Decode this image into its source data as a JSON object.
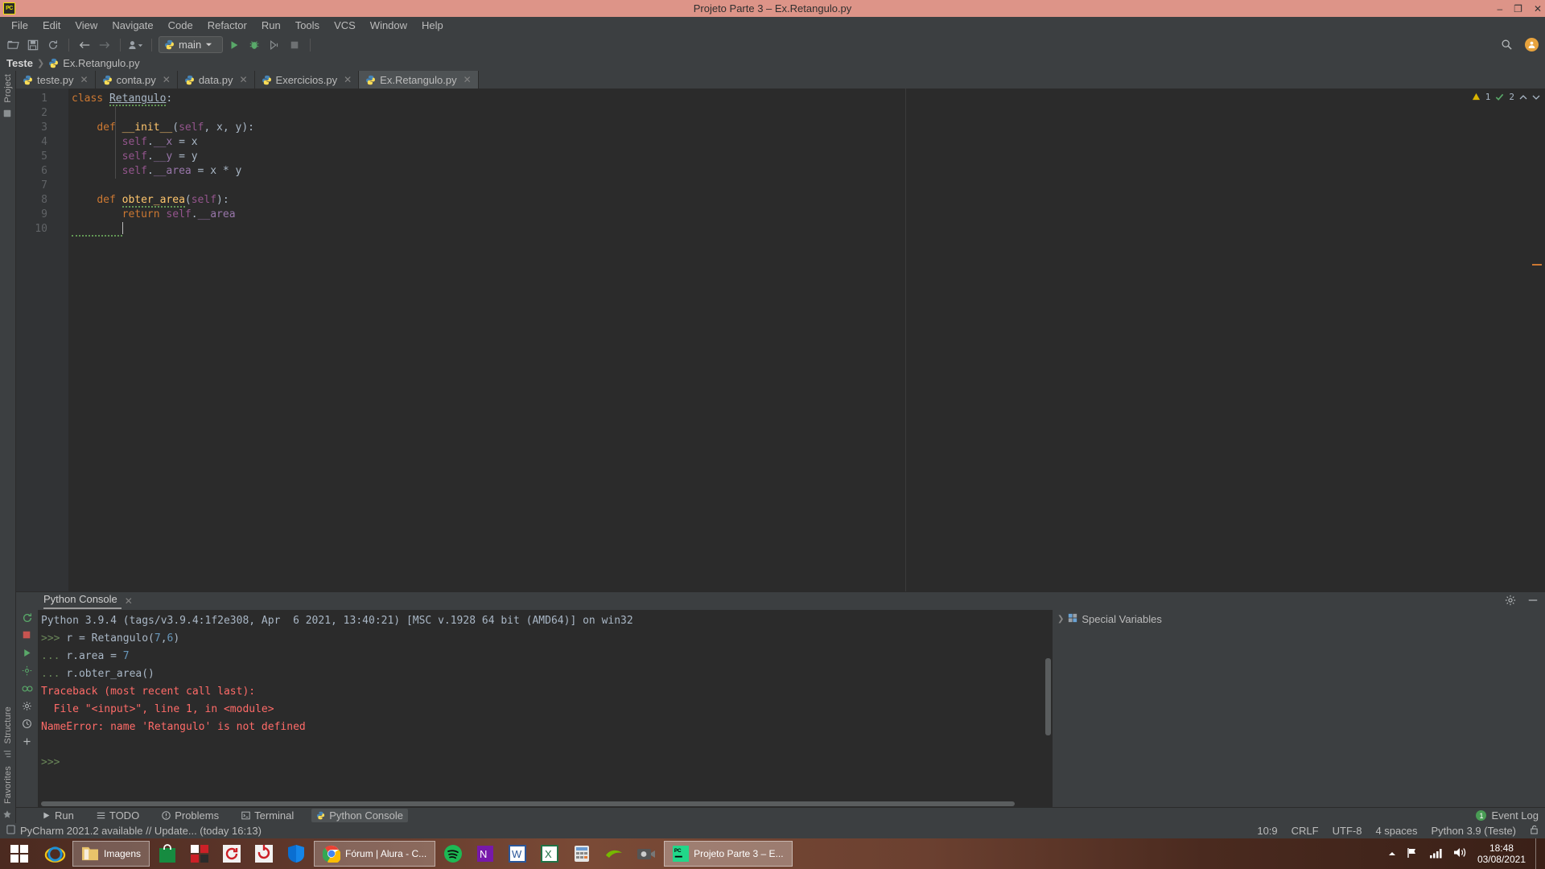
{
  "window": {
    "title": "Projeto Parte 3 – Ex.Retangulo.py",
    "logo_text": "PC",
    "minimize": "–",
    "maximize": "❐",
    "close": "✕"
  },
  "menubar": {
    "items": [
      {
        "label": "File"
      },
      {
        "label": "Edit"
      },
      {
        "label": "View"
      },
      {
        "label": "Navigate"
      },
      {
        "label": "Code"
      },
      {
        "label": "Refactor"
      },
      {
        "label": "Run"
      },
      {
        "label": "Tools"
      },
      {
        "label": "VCS"
      },
      {
        "label": "Window"
      },
      {
        "label": "Help"
      }
    ]
  },
  "toolbar": {
    "open_icon": "folder-open-icon",
    "save_icon": "save-icon",
    "sync_icon": "sync-icon",
    "back_icon": "back-arrow-icon",
    "forward_icon": "forward-arrow-icon",
    "profile_icon": "user-dropdown-icon",
    "run_config": "main",
    "run_icon": "run-icon",
    "debug_icon": "debug-icon",
    "coverage_icon": "run-coverage-icon",
    "stop_icon": "stop-icon",
    "search_icon": "search-icon",
    "account_icon": "account-avatar-icon"
  },
  "breadcrumb": {
    "project": "Teste",
    "separator": "❯",
    "file": "Ex.Retangulo.py"
  },
  "left_rail": {
    "project_label": "Project",
    "structure_label": "Structure",
    "favorites_label": "Favorites"
  },
  "tabs": [
    {
      "label": "teste.py",
      "active": false,
      "close": "✕"
    },
    {
      "label": "conta.py",
      "active": false,
      "close": "✕"
    },
    {
      "label": "data.py",
      "active": false,
      "close": "✕"
    },
    {
      "label": "Exercicios.py",
      "active": false,
      "close": "✕"
    },
    {
      "label": "Ex.Retangulo.py",
      "active": true,
      "close": "✕"
    }
  ],
  "editor": {
    "line_numbers": [
      "1",
      "2",
      "3",
      "4",
      "5",
      "6",
      "7",
      "8",
      "9",
      "10"
    ],
    "lines": [
      {
        "n": 1,
        "tokens": [
          {
            "t": "class ",
            "c": "kw"
          },
          {
            "t": "Retangulo",
            "c": "cls"
          },
          {
            "t": ":",
            "c": "pln"
          }
        ],
        "fold": "open"
      },
      {
        "n": 2,
        "tokens": []
      },
      {
        "n": 3,
        "tokens": [
          {
            "t": "    ",
            "c": "pln"
          },
          {
            "t": "def ",
            "c": "kw"
          },
          {
            "t": "__init__",
            "c": "fn"
          },
          {
            "t": "(",
            "c": "pln"
          },
          {
            "t": "self",
            "c": "slf"
          },
          {
            "t": ", x, y):",
            "c": "pln"
          }
        ],
        "fold": "open"
      },
      {
        "n": 4,
        "tokens": [
          {
            "t": "        ",
            "c": "pln"
          },
          {
            "t": "self",
            "c": "slf"
          },
          {
            "t": ".",
            "c": "pln"
          },
          {
            "t": "__x",
            "c": "pnk"
          },
          {
            "t": " = x",
            "c": "pln"
          }
        ]
      },
      {
        "n": 5,
        "tokens": [
          {
            "t": "        ",
            "c": "pln"
          },
          {
            "t": "self",
            "c": "slf"
          },
          {
            "t": ".",
            "c": "pln"
          },
          {
            "t": "__y",
            "c": "pnk"
          },
          {
            "t": " = y",
            "c": "pln"
          }
        ]
      },
      {
        "n": 6,
        "tokens": [
          {
            "t": "        ",
            "c": "pln"
          },
          {
            "t": "self",
            "c": "slf"
          },
          {
            "t": ".",
            "c": "pln"
          },
          {
            "t": "__area",
            "c": "pnk"
          },
          {
            "t": " = x * y",
            "c": "pln"
          }
        ],
        "fold": "close"
      },
      {
        "n": 7,
        "tokens": []
      },
      {
        "n": 8,
        "tokens": [
          {
            "t": "    ",
            "c": "pln"
          },
          {
            "t": "def ",
            "c": "kw"
          },
          {
            "t": "obter_area",
            "c": "fn"
          },
          {
            "t": "(",
            "c": "pln"
          },
          {
            "t": "self",
            "c": "slf"
          },
          {
            "t": "):",
            "c": "pln"
          }
        ],
        "fold": "open"
      },
      {
        "n": 9,
        "tokens": [
          {
            "t": "        ",
            "c": "pln"
          },
          {
            "t": "return ",
            "c": "kw"
          },
          {
            "t": "self",
            "c": "slf"
          },
          {
            "t": ".",
            "c": "pln"
          },
          {
            "t": "__area",
            "c": "pnk"
          }
        ],
        "fold": "close"
      },
      {
        "n": 10,
        "tokens": []
      }
    ],
    "inspection": {
      "warning_count": "1",
      "ok_count": "2",
      "warning_icon": "warning-triangle-icon",
      "ok_icon": "checkmark-icon",
      "up_icon": "chevron-up-icon",
      "down_icon": "chevron-down-icon"
    }
  },
  "console": {
    "tab_label": "Python Console",
    "tab_close": "✕",
    "settings_icon": "gear-icon",
    "hide_icon": "minimize-icon",
    "side_tools": [
      "rerun-icon",
      "stop-icon",
      "execute-icon",
      "settings-icon",
      "attach-debugger-icon",
      "history-icon",
      "add-icon"
    ],
    "output": [
      {
        "segments": [
          {
            "t": "Python 3.9.4 (tags/v3.9.4:1f2e308, Apr  6 2021, 13:40:21) [MSC v.1928 64 bit (AMD64)] on win32",
            "c": "pln"
          }
        ]
      },
      {
        "segments": [
          {
            "t": ">>> ",
            "c": "green"
          },
          {
            "t": "r = Retangulo(",
            "c": "pln"
          },
          {
            "t": "7",
            "c": "blue"
          },
          {
            "t": ",",
            "c": "pln"
          },
          {
            "t": "6",
            "c": "blue"
          },
          {
            "t": ")",
            "c": "pln"
          }
        ]
      },
      {
        "segments": [
          {
            "t": "... ",
            "c": "green"
          },
          {
            "t": "r.area = ",
            "c": "pln"
          },
          {
            "t": "7",
            "c": "blue"
          }
        ]
      },
      {
        "segments": [
          {
            "t": "... ",
            "c": "green"
          },
          {
            "t": "r.obter_area()",
            "c": "pln"
          }
        ]
      },
      {
        "segments": [
          {
            "t": "Traceback (most recent call last):",
            "c": "red"
          }
        ]
      },
      {
        "segments": [
          {
            "t": "  File \"<input>\", line 1, in <module>",
            "c": "red"
          }
        ]
      },
      {
        "segments": [
          {
            "t": "NameError: name 'Retangulo' is not defined",
            "c": "red"
          }
        ]
      },
      {
        "segments": []
      },
      {
        "segments": [
          {
            "t": ">>>",
            "c": "green"
          }
        ]
      }
    ],
    "special_variables": "Special Variables",
    "special_variables_arrow": "❯",
    "special_variables_icon": "variables-grid-icon"
  },
  "tool_window_bar": {
    "items": [
      {
        "label": "Run",
        "icon": "run-icon",
        "active": false
      },
      {
        "label": "TODO",
        "icon": "todo-list-icon",
        "active": false
      },
      {
        "label": "Problems",
        "icon": "problems-icon",
        "active": false
      },
      {
        "label": "Terminal",
        "icon": "terminal-icon",
        "active": false
      },
      {
        "label": "Python Console",
        "icon": "python-console-icon",
        "active": true
      }
    ],
    "event_log": "Event Log",
    "event_log_badge": "1"
  },
  "status_bar": {
    "message": "PyCharm 2021.2 available // Update... (today 16:13)",
    "message_icon": "notification-icon",
    "caret_position": "10:9",
    "line_separator": "CRLF",
    "encoding": "UTF-8",
    "indent": "4 spaces",
    "interpreter": "Python 3.9 (Teste)",
    "lock_icon": "unlocked-icon"
  },
  "taskbar": {
    "start_icon": "windows-start-icon",
    "items": [
      {
        "name": "internet-explorer-icon",
        "label": ""
      },
      {
        "name": "file-explorer-icon",
        "label": "Imagens"
      },
      {
        "name": "microsoft-store-icon",
        "label": ""
      },
      {
        "name": "app-red-black-icon",
        "label": ""
      },
      {
        "name": "sync-red-icon",
        "label": ""
      },
      {
        "name": "restart-red-icon",
        "label": ""
      },
      {
        "name": "windows-security-icon",
        "label": ""
      },
      {
        "name": "google-chrome-icon",
        "label": "Fórum | Alura - C..."
      },
      {
        "name": "spotify-icon",
        "label": ""
      },
      {
        "name": "onenote-icon",
        "label": ""
      },
      {
        "name": "word-icon",
        "label": ""
      },
      {
        "name": "excel-icon",
        "label": ""
      },
      {
        "name": "calculator-icon",
        "label": ""
      },
      {
        "name": "nvidia-icon",
        "label": ""
      },
      {
        "name": "camera-icon",
        "label": ""
      },
      {
        "name": "pycharm-icon",
        "label": "Projeto Parte 3 – E..."
      }
    ],
    "tray": {
      "expand_icon": "show-hidden-icons-icon",
      "network_icon": "network-icon",
      "signal_icon": "signal-bars-icon",
      "volume_icon": "volume-icon",
      "time": "18:48",
      "date": "03/08/2021"
    }
  },
  "colors": {
    "title_bar": "#dd9488",
    "chrome": "#3c3f41",
    "editor_bg": "#2b2b2b",
    "gutter_bg": "#313335",
    "keyword": "#cc7832",
    "function": "#ffc66d",
    "self": "#94558d",
    "private": "#9876aa",
    "number": "#6897bb",
    "error": "#ff6b68",
    "prompt": "#6a8759"
  }
}
